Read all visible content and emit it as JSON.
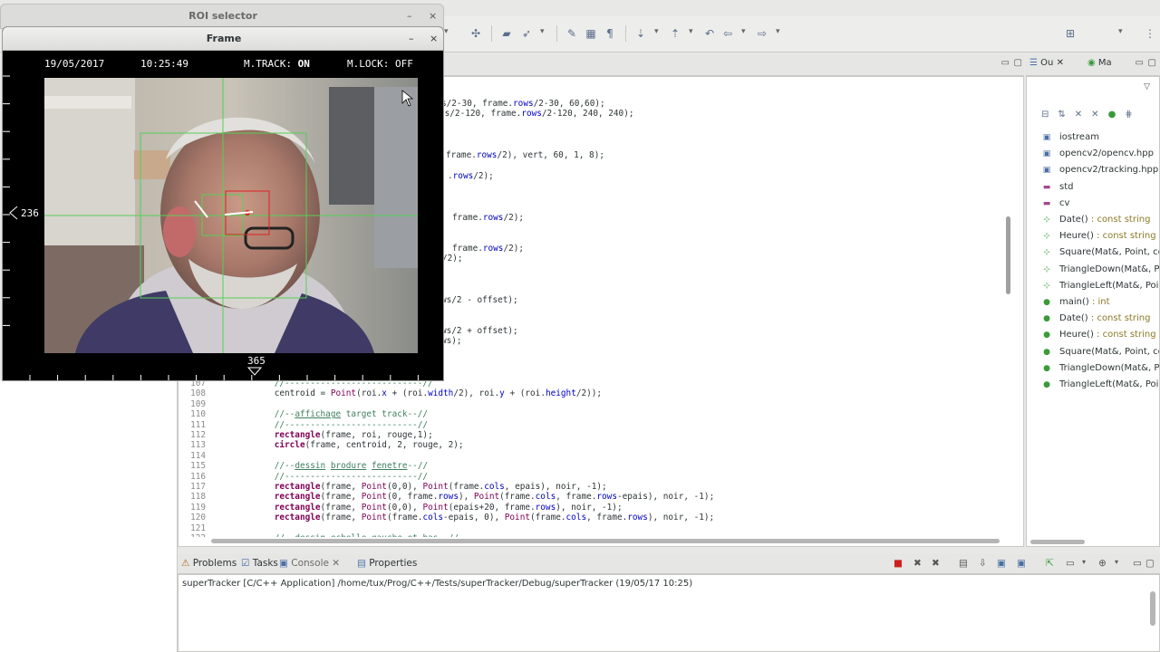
{
  "roi_window": {
    "title": "ROI selector",
    "minimize": "–",
    "close": "×"
  },
  "frame_window": {
    "title": "Frame",
    "minimize": "–",
    "close": "×",
    "hud": {
      "date": "19/05/2017",
      "time": "10:25:49",
      "track_label": "M.TRACK:",
      "track_value": "ON",
      "lock_label": "M.LOCK:",
      "lock_value": "OFF",
      "vertical_value": "236",
      "horizontal_value": "365"
    }
  },
  "code_lines": [
    {
      "num": "",
      "html": "                  <span class=\"cm\">s</span>/2-30, frame.rows/2-30, 60,60);",
      "plain": true
    },
    {
      "num": "",
      "html": "",
      "plain": true
    }
  ],
  "code": {
    "partial_lines": [
      "s/2-30, frame.rows/2-30, 60,60);",
      "ls/2-120, frame.rows/2-120, 240, 240);",
      "frame.rows/2), vert, 60, 1, 8);",
      ".rows/2);",
      "frame.rows/2);",
      "frame.rows/2);",
      "/2);",
      "ws/2 - offset);",
      "ws/2 + offset);",
      "ws);"
    ],
    "lines": [
      {
        "num": "107",
        "text": "            //---------------------------//"
      },
      {
        "num": "108",
        "text": "            centroid = Point(roi.x + (roi.width/2), roi.y + (roi.height/2));"
      },
      {
        "num": "109",
        "text": ""
      },
      {
        "num": "110",
        "text": "            //--affichage target track--//"
      },
      {
        "num": "111",
        "text": "            //--------------------------//"
      },
      {
        "num": "112",
        "text": "            rectangle(frame, roi, rouge,1);"
      },
      {
        "num": "113",
        "text": "            circle(frame, centroid, 2, rouge, 2);"
      },
      {
        "num": "114",
        "text": ""
      },
      {
        "num": "115",
        "text": "            //--dessin brodure fenetre--//"
      },
      {
        "num": "116",
        "text": "            //--------------------------//"
      },
      {
        "num": "117",
        "text": "            rectangle(frame, Point(0,0), Point(frame.cols, epais), noir, -1);"
      },
      {
        "num": "118",
        "text": "            rectangle(frame, Point(0, frame.rows), Point(frame.cols, frame.rows-epais), noir, -1);"
      },
      {
        "num": "119",
        "text": "            rectangle(frame, Point(0,0), Point(epais+20, frame.rows), noir, -1);"
      },
      {
        "num": "120",
        "text": "            rectangle(frame, Point(frame.cols-epais, 0), Point(frame.cols, frame.rows), noir, -1);"
      },
      {
        "num": "121",
        "text": ""
      },
      {
        "num": "122",
        "text": "            //--dessin echelle gauche et bas--//"
      }
    ]
  },
  "outline": {
    "tabs": [
      "Ou",
      "Ma"
    ],
    "items": [
      {
        "label": "iostream",
        "type": "",
        "icon": "include-icon"
      },
      {
        "label": "opencv2/opencv.hpp",
        "type": "",
        "icon": "include-icon"
      },
      {
        "label": "opencv2/tracking.hpp",
        "type": "",
        "icon": "include-icon"
      },
      {
        "label": "std",
        "type": "",
        "icon": "namespace-icon"
      },
      {
        "label": "cv",
        "type": "",
        "icon": "namespace-icon"
      },
      {
        "label": "Date()",
        "type": " : const string",
        "icon": "function-decl-icon"
      },
      {
        "label": "Heure()",
        "type": " : const string",
        "icon": "function-decl-icon"
      },
      {
        "label": "Square(Mat&, Point, co",
        "type": "",
        "icon": "function-decl-icon"
      },
      {
        "label": "TriangleDown(Mat&, Po",
        "type": "",
        "icon": "function-decl-icon"
      },
      {
        "label": "TriangleLeft(Mat&, Poin",
        "type": "",
        "icon": "function-decl-icon"
      },
      {
        "label": "main()",
        "type": " : int",
        "icon": "function-icon"
      },
      {
        "label": "Date()",
        "type": " : const string",
        "icon": "function-icon"
      },
      {
        "label": "Heure()",
        "type": " : const string",
        "icon": "function-icon"
      },
      {
        "label": "Square(Mat&, Point, co",
        "type": "",
        "icon": "function-icon"
      },
      {
        "label": "TriangleDown(Mat&, Po",
        "type": "",
        "icon": "function-icon"
      },
      {
        "label": "TriangleLeft(Mat&, Poin",
        "type": "",
        "icon": "function-icon"
      }
    ]
  },
  "bottom_panel": {
    "tabs": [
      "Problems",
      "Tasks",
      "Console",
      "Properties"
    ],
    "console_path": "superTracker [C/C++ Application] /home/tux/Prog/C++/Tests/superTracker/Debug/superTracker (19/05/17 10:25)"
  },
  "colors": {
    "reticle": "#55d055",
    "target": "#dd2222",
    "keyword": "#7f0055",
    "comment": "#3f7f5f",
    "field": "#0000c0"
  }
}
